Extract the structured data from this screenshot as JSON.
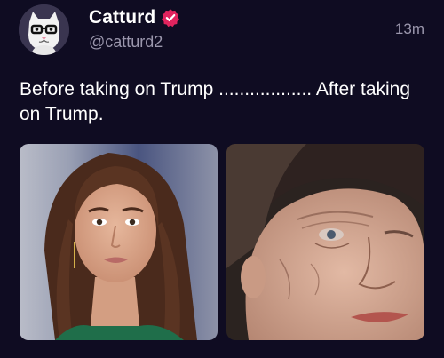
{
  "post": {
    "author": {
      "display_name": "Catturd",
      "handle": "@catturd2",
      "verified": true,
      "avatar": "cat-with-glasses-avatar"
    },
    "timestamp": "13m",
    "text": "Before taking on Trump .................. After taking on Trump.",
    "media": [
      {
        "label": "photo-left-woman-portrait"
      },
      {
        "label": "photo-right-elderly-woman-portrait"
      }
    ]
  },
  "colors": {
    "background": "#0f0c22",
    "text_primary": "#ffffff",
    "text_secondary": "#9b97ad",
    "verified_badge": "#e0245e"
  }
}
